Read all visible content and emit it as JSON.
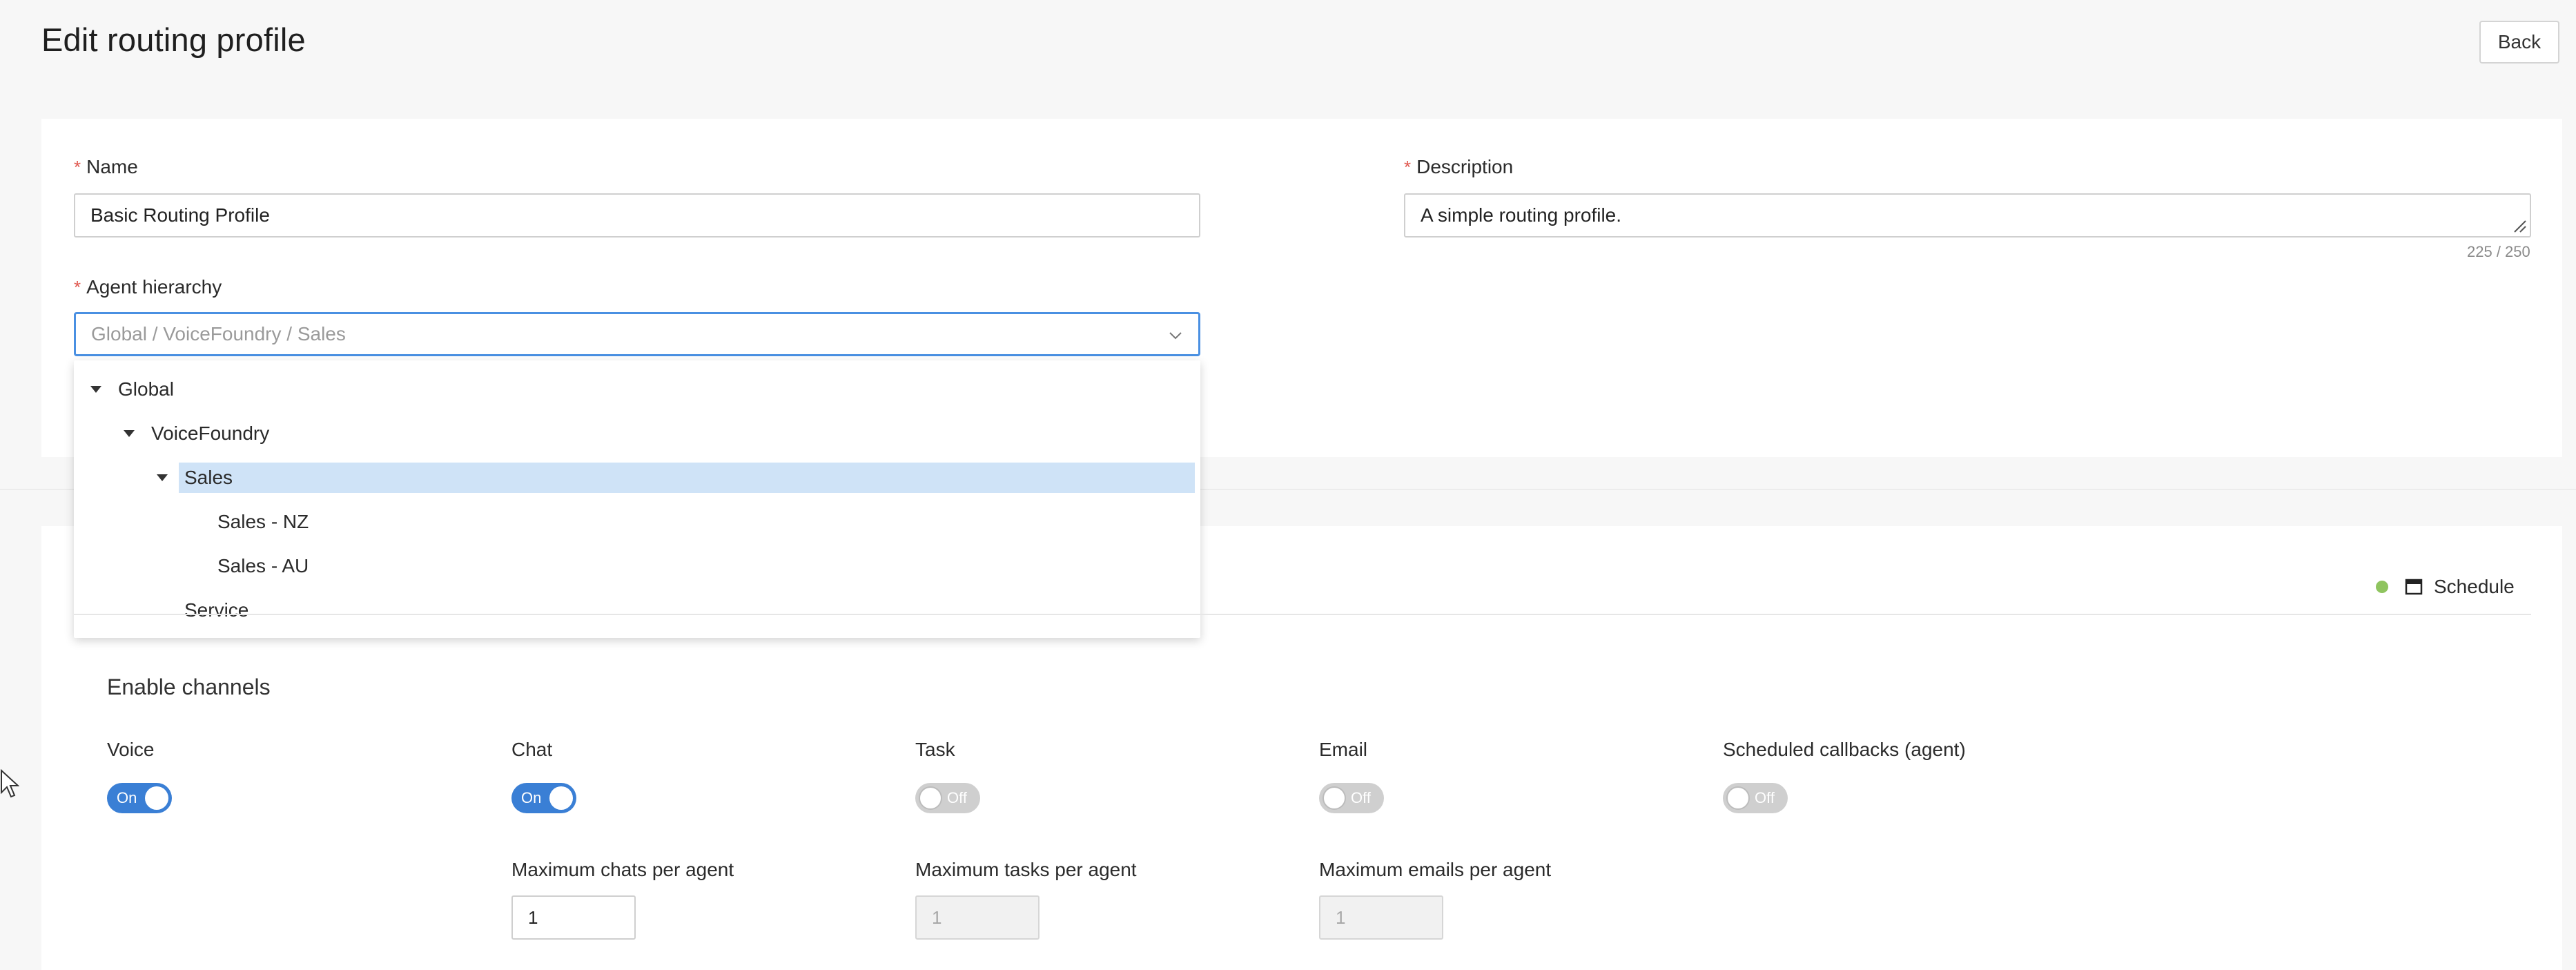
{
  "header": {
    "title": "Edit routing profile",
    "back_label": "Back"
  },
  "form": {
    "name": {
      "label": "Name",
      "value": "Basic Routing Profile"
    },
    "description": {
      "label": "Description",
      "value": "A simple routing profile.",
      "counter": "225 / 250"
    },
    "agent_hierarchy": {
      "label": "Agent hierarchy",
      "placeholder": "Global / VoiceFoundry / Sales",
      "tree": [
        {
          "label": "Global",
          "expanded": true
        },
        {
          "label": "VoiceFoundry",
          "expanded": true
        },
        {
          "label": "Sales",
          "expanded": true,
          "selected": true
        },
        {
          "label": "Sales - NZ"
        },
        {
          "label": "Sales - AU"
        },
        {
          "label": "Service"
        }
      ]
    }
  },
  "schedule": {
    "label": "Schedule",
    "status_color": "#8fc45f"
  },
  "channels": {
    "title": "Enable channels",
    "items": [
      {
        "label": "Voice",
        "state": "On"
      },
      {
        "label": "Chat",
        "state": "On"
      },
      {
        "label": "Task",
        "state": "Off"
      },
      {
        "label": "Email",
        "state": "Off"
      },
      {
        "label": "Scheduled callbacks (agent)",
        "state": "Off"
      }
    ],
    "limits": [
      {
        "label": "Maximum chats per agent",
        "value": "1"
      },
      {
        "label": "Maximum tasks per agent",
        "value": "1"
      },
      {
        "label": "Maximum emails per agent",
        "value": "1"
      }
    ]
  },
  "colors": {
    "accent": "#3a7fd5",
    "selection": "#cfe3f7",
    "required": "#e0584f"
  }
}
